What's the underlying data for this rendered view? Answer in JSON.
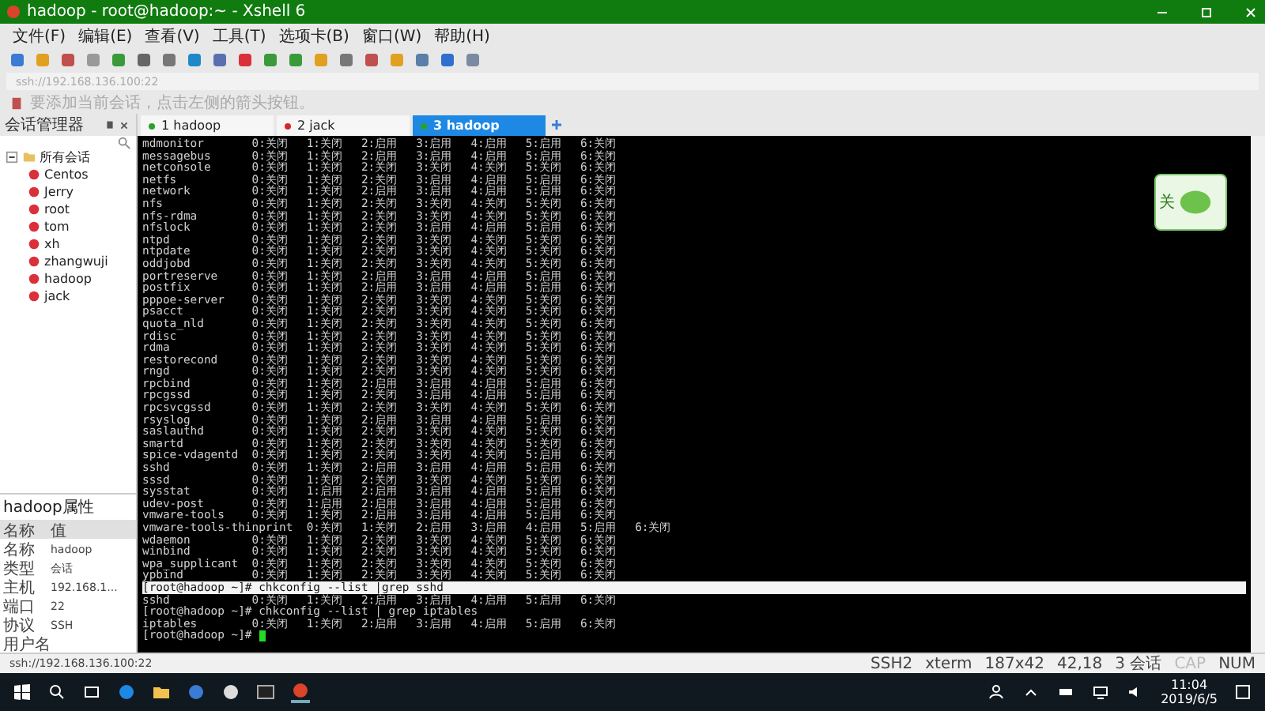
{
  "window": {
    "title": "hadoop - root@hadoop:~ - Xshell 6"
  },
  "menu": [
    "文件(F)",
    "编辑(E)",
    "查看(V)",
    "工具(T)",
    "选项卡(B)",
    "窗口(W)",
    "帮助(H)"
  ],
  "address_bar": {
    "placeholder": "ssh://192.168.136.100:22"
  },
  "hint_bar": {
    "text": "要添加当前会话，点击左侧的箭头按钮。"
  },
  "session_manager": {
    "title": "会话管理器",
    "tree": {
      "label": "所有会话",
      "expanded": true,
      "children": [
        {
          "label": "Centos"
        },
        {
          "label": "Jerry"
        },
        {
          "label": "root"
        },
        {
          "label": "tom"
        },
        {
          "label": "xh"
        },
        {
          "label": "zhangwuji"
        },
        {
          "label": "hadoop"
        },
        {
          "label": "jack"
        }
      ]
    }
  },
  "properties": {
    "title": "hadoop属性",
    "columns": [
      "名称",
      "值"
    ],
    "rows": [
      {
        "name": "名称",
        "value": "hadoop"
      },
      {
        "name": "类型",
        "value": "会话"
      },
      {
        "name": "主机",
        "value": "192.168.1..."
      },
      {
        "name": "端口",
        "value": "22"
      },
      {
        "name": "协议",
        "value": "SSH"
      },
      {
        "name": "用户名"
      }
    ]
  },
  "tabs": [
    {
      "label": "1 hadoop",
      "color": "#2ca02c",
      "selected": false
    },
    {
      "label": "2 jack",
      "color": "#d62728",
      "selected": false
    },
    {
      "label": "3 hadoop",
      "color": "#2ca02c",
      "selected": true
    }
  ],
  "terminal": {
    "cursor": true,
    "lines": [
      {
        "text": "mdmonitor\t0:关闭\t1:关闭\t2:启用\t3:启用\t4:启用\t5:启用\t6:关闭",
        "selected": false
      },
      {
        "text": "messagebus\t0:关闭\t1:关闭\t2:启用\t3:启用\t4:启用\t5:启用\t6:关闭",
        "selected": false
      },
      {
        "text": "netconsole\t0:关闭\t1:关闭\t2:关闭\t3:关闭\t4:关闭\t5:关闭\t6:关闭",
        "selected": false
      },
      {
        "text": "netfs\t\t0:关闭\t1:关闭\t2:关闭\t3:启用\t4:启用\t5:启用\t6:关闭",
        "selected": false
      },
      {
        "text": "network\t\t0:关闭\t1:关闭\t2:启用\t3:启用\t4:启用\t5:启用\t6:关闭",
        "selected": false
      },
      {
        "text": "nfs\t\t0:关闭\t1:关闭\t2:关闭\t3:关闭\t4:关闭\t5:关闭\t6:关闭",
        "selected": false
      },
      {
        "text": "nfs-rdma\t0:关闭\t1:关闭\t2:关闭\t3:关闭\t4:关闭\t5:关闭\t6:关闭",
        "selected": false
      },
      {
        "text": "nfslock\t\t0:关闭\t1:关闭\t2:关闭\t3:启用\t4:启用\t5:启用\t6:关闭",
        "selected": false
      },
      {
        "text": "ntpd\t\t0:关闭\t1:关闭\t2:关闭\t3:关闭\t4:关闭\t5:关闭\t6:关闭",
        "selected": false
      },
      {
        "text": "ntpdate\t\t0:关闭\t1:关闭\t2:关闭\t3:关闭\t4:关闭\t5:关闭\t6:关闭",
        "selected": false
      },
      {
        "text": "oddjobd\t\t0:关闭\t1:关闭\t2:关闭\t3:关闭\t4:关闭\t5:关闭\t6:关闭",
        "selected": false
      },
      {
        "text": "portreserve\t0:关闭\t1:关闭\t2:启用\t3:启用\t4:启用\t5:启用\t6:关闭",
        "selected": false
      },
      {
        "text": "postfix\t\t0:关闭\t1:关闭\t2:启用\t3:启用\t4:启用\t5:启用\t6:关闭",
        "selected": false
      },
      {
        "text": "pppoe-server\t0:关闭\t1:关闭\t2:关闭\t3:关闭\t4:关闭\t5:关闭\t6:关闭",
        "selected": false
      },
      {
        "text": "psacct\t\t0:关闭\t1:关闭\t2:关闭\t3:关闭\t4:关闭\t5:关闭\t6:关闭",
        "selected": false
      },
      {
        "text": "quota_nld\t0:关闭\t1:关闭\t2:关闭\t3:关闭\t4:关闭\t5:关闭\t6:关闭",
        "selected": false
      },
      {
        "text": "rdisc\t\t0:关闭\t1:关闭\t2:关闭\t3:关闭\t4:关闭\t5:关闭\t6:关闭",
        "selected": false
      },
      {
        "text": "rdma\t\t0:关闭\t1:关闭\t2:关闭\t3:关闭\t4:关闭\t5:关闭\t6:关闭",
        "selected": false
      },
      {
        "text": "restorecond\t0:关闭\t1:关闭\t2:关闭\t3:关闭\t4:关闭\t5:关闭\t6:关闭",
        "selected": false
      },
      {
        "text": "rngd\t\t0:关闭\t1:关闭\t2:关闭\t3:关闭\t4:关闭\t5:关闭\t6:关闭",
        "selected": false
      },
      {
        "text": "rpcbind\t\t0:关闭\t1:关闭\t2:启用\t3:启用\t4:启用\t5:启用\t6:关闭",
        "selected": false
      },
      {
        "text": "rpcgssd\t\t0:关闭\t1:关闭\t2:关闭\t3:启用\t4:启用\t5:启用\t6:关闭",
        "selected": false
      },
      {
        "text": "rpcsvcgssd\t0:关闭\t1:关闭\t2:关闭\t3:关闭\t4:关闭\t5:关闭\t6:关闭",
        "selected": false
      },
      {
        "text": "rsyslog\t\t0:关闭\t1:关闭\t2:启用\t3:启用\t4:启用\t5:启用\t6:关闭",
        "selected": false
      },
      {
        "text": "saslauthd\t0:关闭\t1:关闭\t2:关闭\t3:关闭\t4:关闭\t5:关闭\t6:关闭",
        "selected": false
      },
      {
        "text": "smartd\t\t0:关闭\t1:关闭\t2:关闭\t3:关闭\t4:关闭\t5:关闭\t6:关闭",
        "selected": false
      },
      {
        "text": "spice-vdagentd\t0:关闭\t1:关闭\t2:关闭\t3:关闭\t4:关闭\t5:启用\t6:关闭",
        "selected": false
      },
      {
        "text": "sshd\t\t0:关闭\t1:关闭\t2:启用\t3:启用\t4:启用\t5:启用\t6:关闭",
        "selected": false
      },
      {
        "text": "sssd\t\t0:关闭\t1:关闭\t2:关闭\t3:关闭\t4:关闭\t5:关闭\t6:关闭",
        "selected": false
      },
      {
        "text": "sysstat\t\t0:关闭\t1:启用\t2:启用\t3:启用\t4:启用\t5:启用\t6:关闭",
        "selected": false
      },
      {
        "text": "udev-post\t0:关闭\t1:启用\t2:启用\t3:启用\t4:启用\t5:启用\t6:关闭",
        "selected": false
      },
      {
        "text": "vmware-tools\t0:关闭\t1:关闭\t2:启用\t3:启用\t4:启用\t5:启用\t6:关闭",
        "selected": false
      },
      {
        "text": "vmware-tools-thinprint\t0:关闭\t1:关闭\t2:启用\t3:启用\t4:启用\t5:启用\t6:关闭",
        "selected": false
      },
      {
        "text": "wdaemon\t\t0:关闭\t1:关闭\t2:关闭\t3:关闭\t4:关闭\t5:关闭\t6:关闭",
        "selected": false
      },
      {
        "text": "winbind\t\t0:关闭\t1:关闭\t2:关闭\t3:关闭\t4:关闭\t5:关闭\t6:关闭",
        "selected": false
      },
      {
        "text": "wpa_supplicant\t0:关闭\t1:关闭\t2:关闭\t3:关闭\t4:关闭\t5:关闭\t6:关闭",
        "selected": false
      },
      {
        "text": "ypbind\t\t0:关闭\t1:关闭\t2:关闭\t3:关闭\t4:关闭\t5:关闭\t6:关闭",
        "selected": false
      },
      {
        "text": "[root@hadoop ~]# chkconfig --list |grep sshd",
        "selected": true
      },
      {
        "text": "sshd\t\t0:关闭\t1:关闭\t2:启用\t3:启用\t4:启用\t5:启用\t6:关闭",
        "selected": false
      },
      {
        "text": "[root@hadoop ~]# chkconfig --list | grep iptables",
        "selected": false
      },
      {
        "text": "iptables\t0:关闭\t1:关闭\t2:启用\t3:启用\t4:启用\t5:启用\t6:关闭",
        "selected": false
      },
      {
        "text": "[root@hadoop ~]# ",
        "selected": false
      }
    ]
  },
  "widget": {
    "text": "关"
  },
  "status_bar": {
    "left": "ssh://192.168.136.100:22",
    "items": [
      {
        "text": "SSH2",
        "disabled": false
      },
      {
        "text": "xterm",
        "disabled": false
      },
      {
        "text": "187x42",
        "disabled": false
      },
      {
        "text": "42,18",
        "disabled": false
      },
      {
        "text": "3 会话",
        "disabled": false
      },
      {
        "text": "CAP",
        "disabled": true
      },
      {
        "text": "NUM",
        "disabled": false
      }
    ]
  },
  "taskbar": {
    "time": "11:04",
    "date": "2019/6/5"
  }
}
